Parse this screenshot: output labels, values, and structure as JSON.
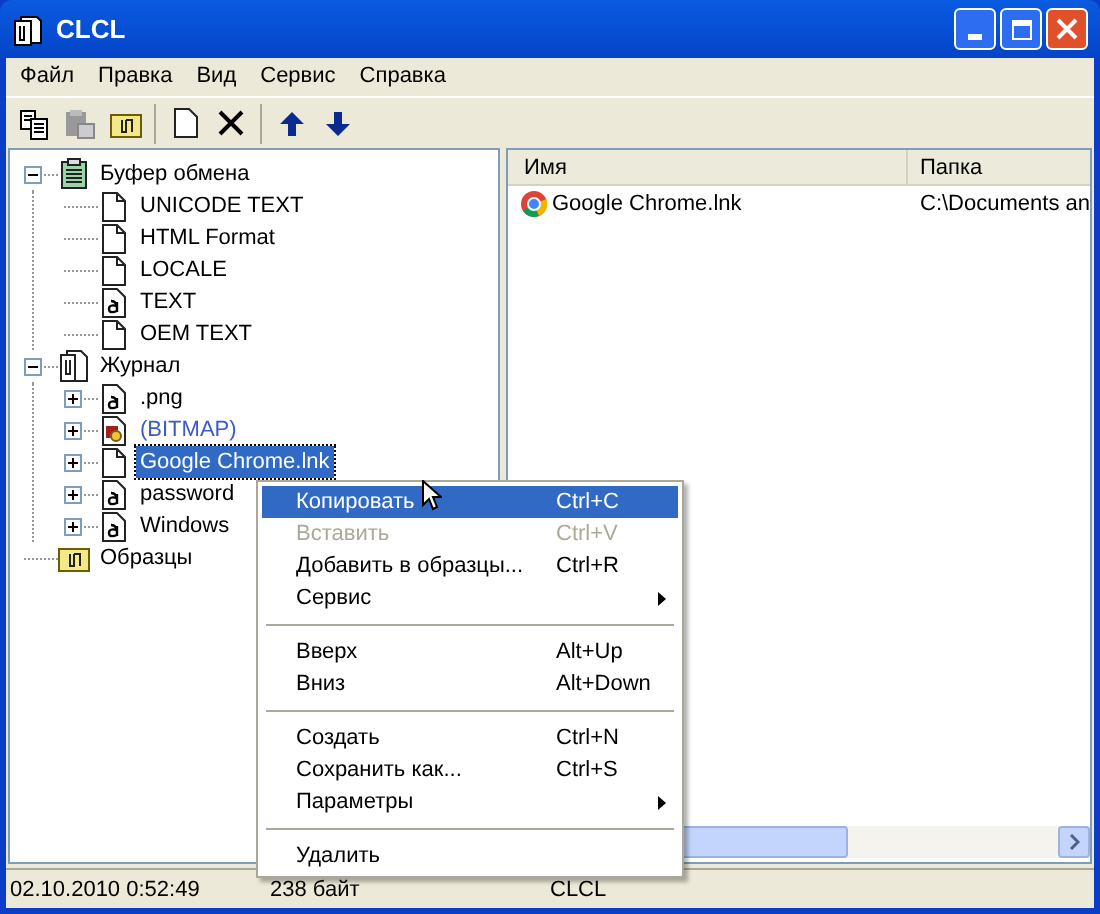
{
  "window": {
    "title": "CLCL"
  },
  "menu_bar": [
    "Файл",
    "Правка",
    "Вид",
    "Сервис",
    "Справка"
  ],
  "tree": [
    {
      "label": "Буфер обмена",
      "kind": "clipboard",
      "expanded": true,
      "selected": false,
      "children": [
        {
          "label": "UNICODE TEXT",
          "kind": "doc",
          "selected": false
        },
        {
          "label": "HTML Format",
          "kind": "doc",
          "selected": false
        },
        {
          "label": "LOCALE",
          "kind": "doc",
          "selected": false
        },
        {
          "label": "TEXT",
          "kind": "text",
          "selected": false
        },
        {
          "label": "OEM TEXT",
          "kind": "doc",
          "selected": false
        }
      ]
    },
    {
      "label": "Журнал",
      "kind": "journal",
      "expanded": true,
      "selected": false,
      "children": [
        {
          "label": ".png",
          "kind": "text",
          "expanded": false,
          "selected": false
        },
        {
          "label": "(BITMAP)",
          "kind": "bitmap",
          "expanded": false,
          "selected": false,
          "color": "#3b5bc8"
        },
        {
          "label": "Google Chrome.lnk",
          "kind": "doc",
          "expanded": false,
          "selected": true
        },
        {
          "label": "password",
          "kind": "text",
          "expanded": false,
          "selected": false
        },
        {
          "label": "Windows",
          "kind": "text",
          "expanded": false,
          "selected": false
        }
      ]
    },
    {
      "label": "Образцы",
      "kind": "folder",
      "selected": false
    }
  ],
  "list": {
    "columns": [
      "Имя",
      "Папка"
    ],
    "rows": [
      {
        "name": "Google Chrome.lnk",
        "folder": "C:\\Documents an"
      }
    ]
  },
  "context_menu": [
    {
      "kind": "item",
      "label": "Копировать",
      "shortcut": "Ctrl+C",
      "selected": true,
      "disabled": false
    },
    {
      "kind": "item",
      "label": "Вставить",
      "shortcut": "Ctrl+V",
      "selected": false,
      "disabled": true
    },
    {
      "kind": "item",
      "label": "Добавить в образцы...",
      "shortcut": "Ctrl+R",
      "selected": false,
      "disabled": false
    },
    {
      "kind": "submenu",
      "label": "Сервис",
      "selected": false,
      "disabled": false
    },
    {
      "kind": "separator"
    },
    {
      "kind": "item",
      "label": "Вверх",
      "shortcut": "Alt+Up",
      "selected": false,
      "disabled": false
    },
    {
      "kind": "item",
      "label": "Вниз",
      "shortcut": "Alt+Down",
      "selected": false,
      "disabled": false
    },
    {
      "kind": "separator"
    },
    {
      "kind": "item",
      "label": "Создать",
      "shortcut": "Ctrl+N",
      "selected": false,
      "disabled": false
    },
    {
      "kind": "item",
      "label": "Сохранить как...",
      "shortcut": "Ctrl+S",
      "selected": false,
      "disabled": false
    },
    {
      "kind": "submenu",
      "label": "Параметры",
      "selected": false,
      "disabled": false
    },
    {
      "kind": "separator"
    },
    {
      "kind": "item",
      "label": "Удалить",
      "selected": false,
      "disabled": false
    }
  ],
  "status_bar": [
    "02.10.2010 0:52:49",
    "238 байт",
    "CLCL"
  ]
}
